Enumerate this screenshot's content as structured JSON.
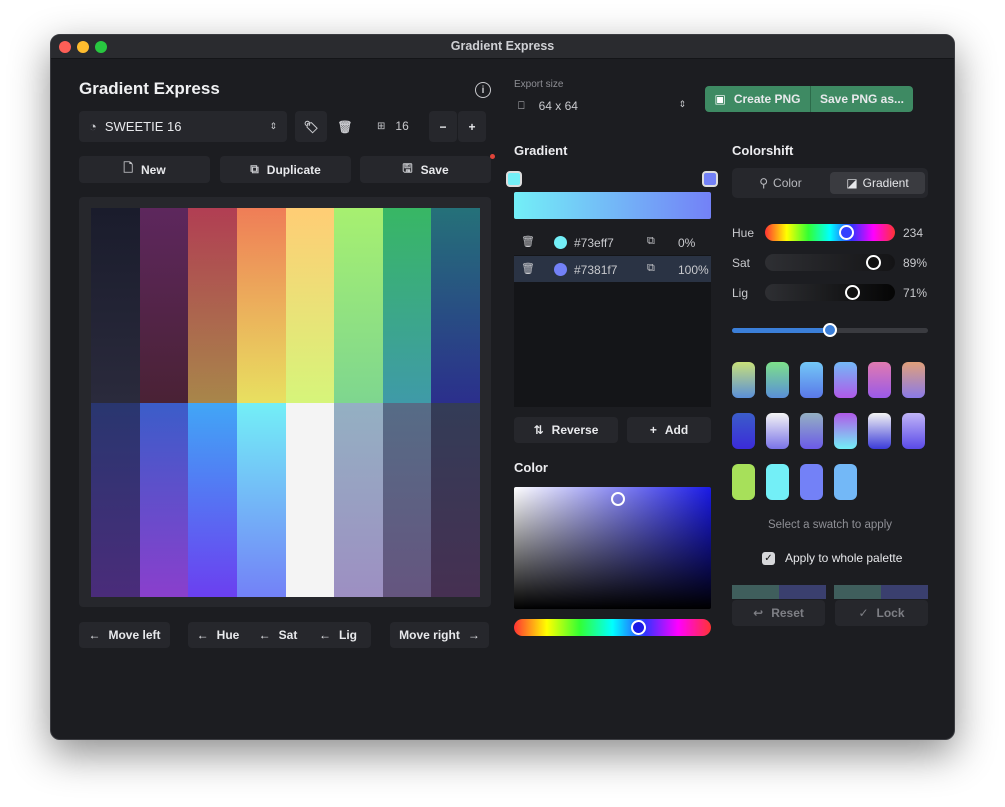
{
  "window": {
    "title": "Gradient Express"
  },
  "app": {
    "title": "Gradient Express"
  },
  "palette": {
    "name": "SWEETIE 16",
    "count": "16"
  },
  "actions": {
    "new": "New",
    "duplicate": "Duplicate",
    "save": "Save"
  },
  "export": {
    "label": "Export size",
    "size": "64 x 64",
    "create_png": "Create PNG",
    "save_png_as": "Save PNG as..."
  },
  "gradient": {
    "title": "Gradient",
    "start_color": "#73eff7",
    "end_color": "#7381f7",
    "stops": [
      {
        "hex": "#73eff7",
        "pos": "0%",
        "color": "#73eff7"
      },
      {
        "hex": "#7381f7",
        "pos": "100%",
        "color": "#7381f7"
      }
    ],
    "reverse": "Reverse",
    "add": "Add"
  },
  "color": {
    "title": "Color",
    "picker_hue": "#1a1ae6"
  },
  "colorshift": {
    "title": "Colorshift",
    "tab_color": "Color",
    "tab_gradient": "Gradient",
    "hue_label": "Hue",
    "hue_value": "234",
    "sat_label": "Sat",
    "sat_value": "89%",
    "lig_label": "Lig",
    "lig_value": "71%",
    "hint": "Select a swatch to apply",
    "apply_label": "Apply to whole palette",
    "reset": "Reset",
    "lock": "Lock"
  },
  "bottom": {
    "move_left": "Move left",
    "hue": "Hue",
    "sat": "Sat",
    "lig": "Lig",
    "move_right": "Move right"
  },
  "grid": {
    "top": [
      [
        "#1a1c2c",
        "#2a2a3c"
      ],
      [
        "#5d275d",
        "#4a2235"
      ],
      [
        "#b13e53",
        "#a8864a"
      ],
      [
        "#ef7d57",
        "#e8e060"
      ],
      [
        "#ffcd75",
        "#d6f57a"
      ],
      [
        "#a7f070",
        "#7ed68f"
      ],
      [
        "#38b764",
        "#3f9aa8"
      ],
      [
        "#257179",
        "#2b2f8c"
      ]
    ],
    "bottom": [
      [
        "#29366f",
        "#4a2c7a"
      ],
      [
        "#3b5dc9",
        "#8a3fcc"
      ],
      [
        "#41a6f6",
        "#6b3ff0"
      ],
      [
        "#73eff7",
        "#7381f7"
      ],
      [
        "#f4f4f4",
        "#f4f4f4"
      ],
      [
        "#94b0c2",
        "#9d8fc2"
      ],
      [
        "#566c86",
        "#65557f"
      ],
      [
        "#333c57",
        "#463052"
      ]
    ]
  },
  "swatches": [
    [
      "#c8e07a",
      "#5a8fd8"
    ],
    [
      "#7ee08a",
      "#5a8fd8"
    ],
    [
      "#73c8f7",
      "#5a78e8"
    ],
    [
      "#73b8f7",
      "#b05ae8"
    ],
    [
      "#e07ab0",
      "#9a5ae8"
    ],
    [
      "#e0a07a",
      "#8a7ae8"
    ],
    [
      "#3b5dc9",
      "#3b2bd9"
    ],
    [
      "#f4f4f4",
      "#7a73e8"
    ],
    [
      "#94b0c2",
      "#6b5ae8"
    ],
    [
      "#b05ae8",
      "#73eff7"
    ],
    [
      "#f4f4f4",
      "#3b3bd9"
    ],
    [
      "#c0b4f7",
      "#5a4ae8"
    ],
    [
      "#a7e05a",
      "#a7e05a"
    ],
    [
      "#73eff7",
      "#73eff7"
    ],
    [
      "#7381f7",
      "#7381f7"
    ],
    [
      "#73b8f7",
      "#73b8f7"
    ]
  ],
  "strip": [
    "#3f5e5c",
    "#3a3f6e",
    "#1c1d21",
    "#3f5e5c",
    "#3a3f6e"
  ],
  "colors": {
    "accent_green": "#3e8a63",
    "panel": "#26272c",
    "window": "#1c1d21",
    "slider_blue": "#3b7fd9"
  }
}
